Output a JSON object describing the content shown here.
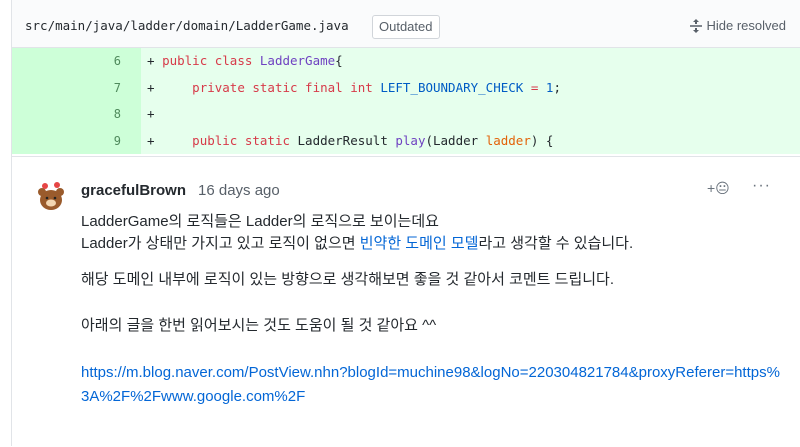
{
  "file_header": {
    "path": "src/main/java/ladder/domain/LadderGame.java",
    "badge": "Outdated",
    "hide_resolved": "Hide resolved",
    "hide_icon": "unfold-icon"
  },
  "diff": {
    "lines": [
      {
        "num": "6",
        "prefix": "+ ",
        "tokens": [
          [
            "kw",
            "public class "
          ],
          [
            "ent",
            "LadderGame"
          ],
          [
            "",
            "{"
          ]
        ]
      },
      {
        "num": "7",
        "prefix": "+ ",
        "tokens": [
          [
            "",
            "    "
          ],
          [
            "kw",
            "private static final int "
          ],
          [
            "cst",
            "LEFT_BOUNDARY_CHECK"
          ],
          [
            "kw",
            " = "
          ],
          [
            "cst",
            "1"
          ],
          [
            "",
            ";"
          ]
        ]
      },
      {
        "num": "8",
        "prefix": "+ ",
        "tokens": []
      },
      {
        "num": "9",
        "prefix": "+ ",
        "tokens": [
          [
            "",
            "    "
          ],
          [
            "kw",
            "public static "
          ],
          [
            "",
            "LadderResult "
          ],
          [
            "ent",
            "play"
          ],
          [
            "",
            "(Ladder "
          ],
          [
            "var",
            "ladder"
          ],
          [
            "",
            ") {"
          ]
        ]
      }
    ]
  },
  "comment": {
    "author": "gracefulBrown",
    "timestamp": "16 days ago",
    "reaction_label": "+😐",
    "more_label": "···",
    "line1": "LadderGame의 로직들은 Ladder의 로직으로 보이는데요",
    "line2_before": "Ladder가 상태만 가지고 있고 로직이 없으면 ",
    "line2_link": "빈약한 도메인 모델",
    "line2_after": "라고 생각할 수 있습니다.",
    "para2": "해당 도메인 내부에 로직이 있는 방향으로 생각해보면 좋을 것 같아서 코멘트 드립니다.",
    "para3": "아래의 글을 한번 읽어보시는 것도 도움이 될 것 같아요 ^^",
    "url": "https://m.blog.naver.com/PostView.nhn?blogId=muchine98&logNo=220304821784&proxyReferer=https%3A%2F%2Fwww.google.com%2F"
  }
}
